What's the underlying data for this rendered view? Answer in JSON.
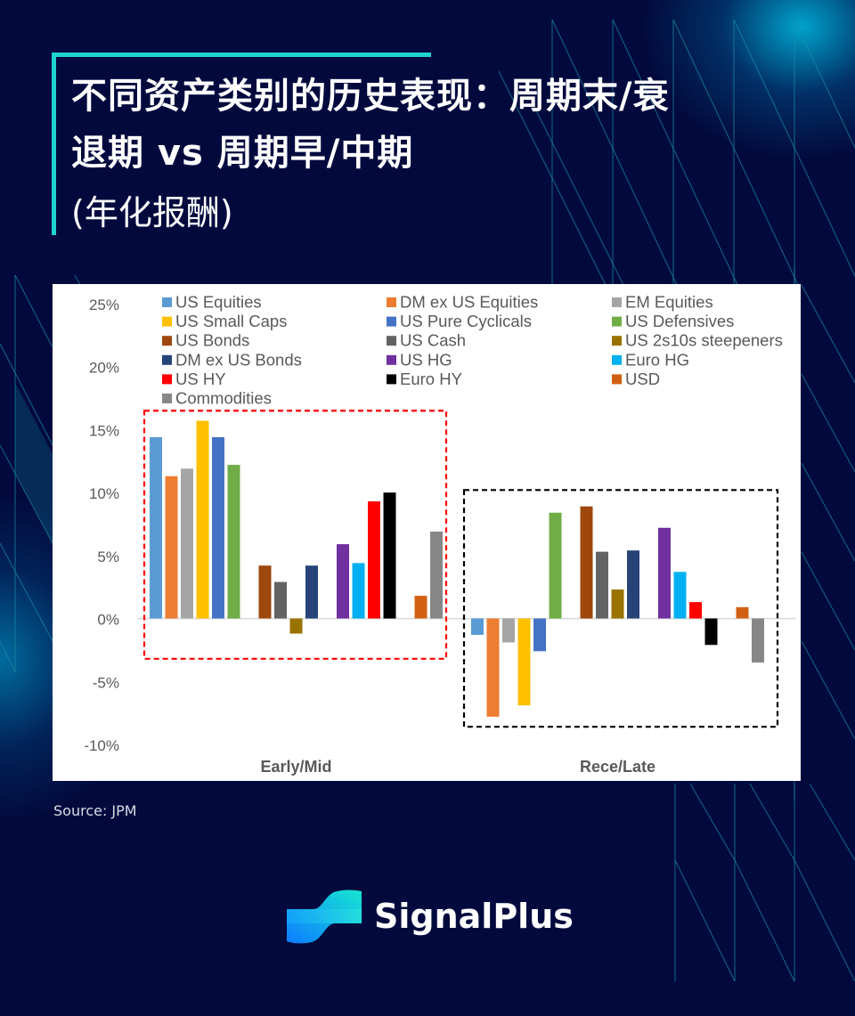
{
  "header": {
    "title_line1": "不同资产类别的历史表现：周期末/衰",
    "title_line2": "退期 vs 周期早/中期",
    "subtitle": "(年化报酬)"
  },
  "footer": {
    "source": "Source: JPM",
    "brand_name": "SignalPlus",
    "brand_icon": "signalplus-logo-icon"
  },
  "theme": {
    "background": "#020a3d",
    "accent": "#1fd3d0",
    "early_box_color": "#ff0000",
    "late_box_color": "#000000"
  },
  "chart_data": {
    "type": "bar",
    "title": "",
    "xlabel": "",
    "ylabel": "",
    "categories": [
      "Early/Mid",
      "Rece/Late"
    ],
    "ylim": [
      -10,
      25
    ],
    "yticks": [
      25,
      20,
      15,
      10,
      5,
      0,
      -5,
      -10
    ],
    "ytick_labels": [
      "25%",
      "20%",
      "15%",
      "10%",
      "5%",
      "0%",
      "-5%",
      "-10%"
    ],
    "grid": false,
    "legend_position": "top",
    "highlight_boxes": [
      {
        "category": "Early/Mid",
        "style": "dashed",
        "color": "#ff0000",
        "range": [
          -3.2,
          16.5
        ]
      },
      {
        "category": "Rece/Late",
        "style": "dashed",
        "color": "#000000",
        "range": [
          -8.6,
          10.2
        ]
      }
    ],
    "series": [
      {
        "name": "US Equities",
        "color": "#5b9bd5",
        "values": [
          14.4,
          -1.3
        ],
        "gap_before": false
      },
      {
        "name": "DM ex US Equities",
        "color": "#ed7d31",
        "values": [
          11.3,
          -7.8
        ],
        "gap_before": false
      },
      {
        "name": "EM Equities",
        "color": "#a5a5a5",
        "values": [
          11.9,
          -1.9
        ],
        "gap_before": false
      },
      {
        "name": "US Small Caps",
        "color": "#ffc000",
        "values": [
          15.7,
          -6.9
        ],
        "gap_before": false
      },
      {
        "name": "US Pure Cyclicals",
        "color": "#4472c4",
        "values": [
          14.4,
          -2.6
        ],
        "gap_before": false
      },
      {
        "name": "US Defensives",
        "color": "#70ad47",
        "values": [
          12.2,
          8.4
        ],
        "gap_before": false
      },
      {
        "name": "US Bonds",
        "color": "#9e480e",
        "values": [
          4.2,
          8.9
        ],
        "gap_before": true
      },
      {
        "name": "US Cash",
        "color": "#636363",
        "values": [
          2.9,
          5.3
        ],
        "gap_before": false
      },
      {
        "name": "US 2s10s steepeners",
        "color": "#997300",
        "values": [
          -1.2,
          2.3
        ],
        "gap_before": false
      },
      {
        "name": "DM ex US Bonds",
        "color": "#264478",
        "values": [
          4.2,
          5.4
        ],
        "gap_before": false
      },
      {
        "name": "US HG",
        "color": "#7030a0",
        "values": [
          5.9,
          7.2
        ],
        "gap_before": true
      },
      {
        "name": "Euro HG",
        "color": "#00b0f0",
        "values": [
          4.4,
          3.7
        ],
        "gap_before": false
      },
      {
        "name": "US HY",
        "color": "#ff0000",
        "values": [
          9.3,
          1.3
        ],
        "gap_before": false
      },
      {
        "name": "Euro HY",
        "color": "#000000",
        "values": [
          10.0,
          -2.1
        ],
        "gap_before": false
      },
      {
        "name": "USD",
        "color": "#d26012",
        "values": [
          1.8,
          0.9
        ],
        "gap_before": true
      },
      {
        "name": "Commodities",
        "color": "#878787",
        "values": [
          6.9,
          -3.5
        ],
        "gap_before": false
      }
    ]
  }
}
